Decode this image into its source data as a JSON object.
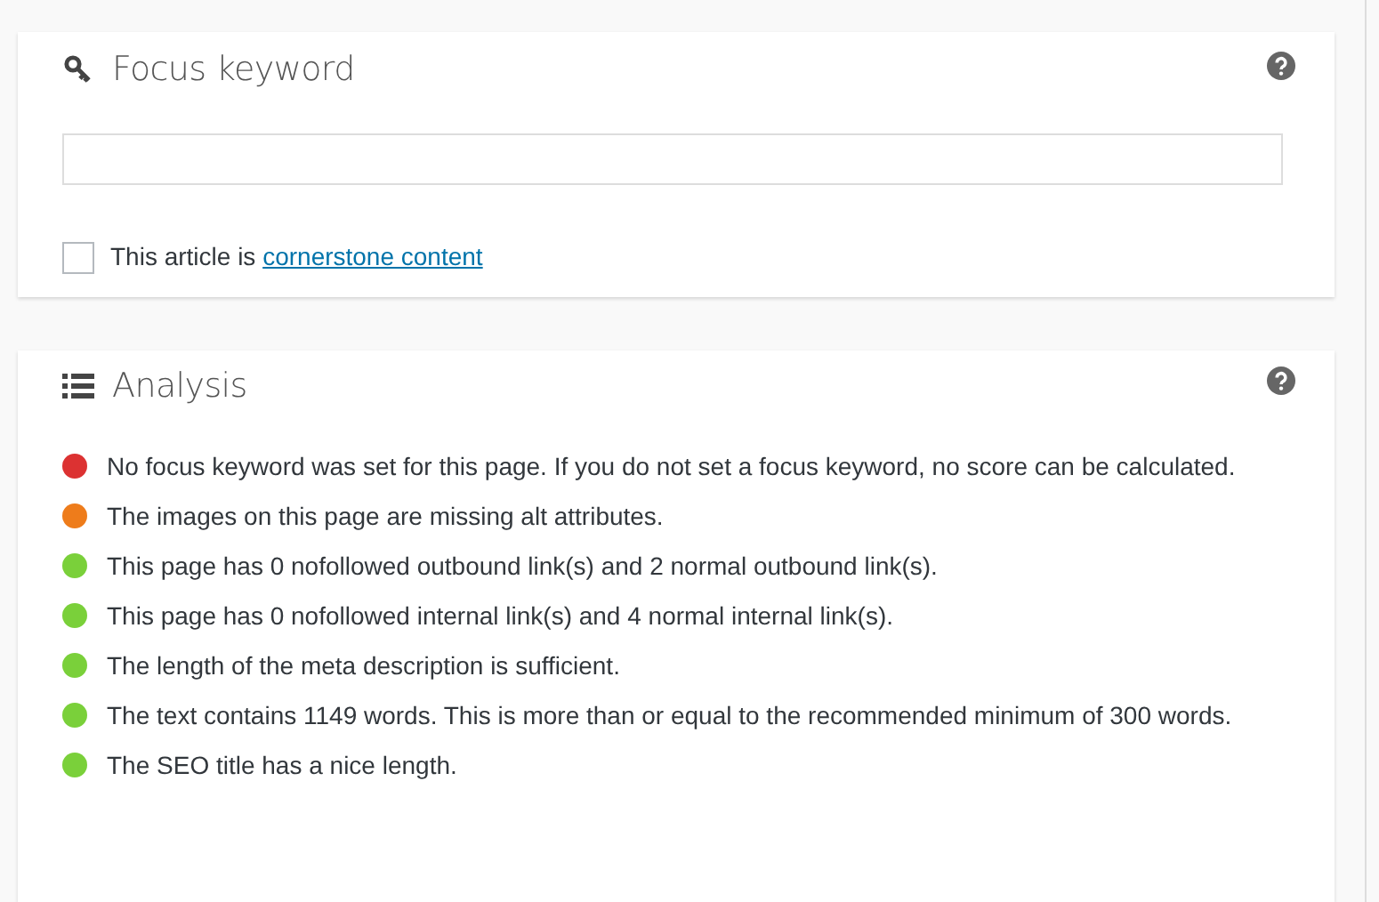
{
  "focus_keyword": {
    "title": "Focus keyword",
    "cornerstone": {
      "checked": false,
      "text": "This article is ",
      "link": "cornerstone content"
    }
  },
  "analysis": {
    "title": "Analysis",
    "results": [
      {
        "color": "#dc3232",
        "text": "No focus keyword was set for this page. If you do not set a focus keyword, no score can be calculated."
      },
      {
        "color": "#ee7c1b",
        "text": "The images on this page are missing alt attributes."
      },
      {
        "color": "#7ad03a",
        "text": "This page has 0 nofollowed outbound link(s) and 2 normal outbound link(s)."
      },
      {
        "color": "#7ad03a",
        "text": "This page has 0 nofollowed internal link(s) and 4 normal internal link(s)."
      },
      {
        "color": "#7ad03a",
        "text": "The length of the meta description is sufficient."
      },
      {
        "color": "#7ad03a",
        "text": "The text contains 1149 words. This is more than or equal to the recommended minimum of 300 words."
      },
      {
        "color": "#7ad03a",
        "text": "The SEO title has a nice length."
      }
    ]
  }
}
